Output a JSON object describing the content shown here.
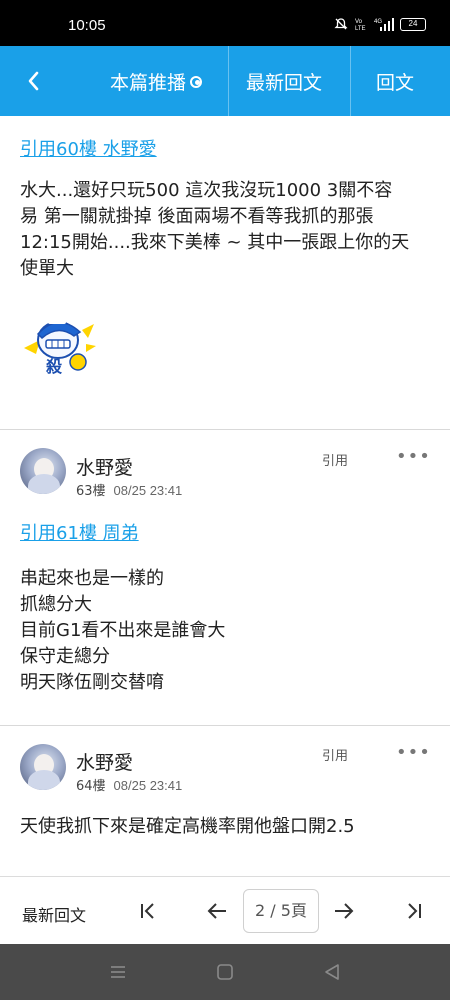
{
  "status_bar": {
    "time": "10:05",
    "battery": "24",
    "icons": [
      "mute-icon",
      "volte-icon",
      "4g-signal-icon",
      "battery-icon"
    ]
  },
  "navbar": {
    "back_icon": "chevron-left-icon",
    "tabs": [
      {
        "label": "本篇推播"
      },
      {
        "label": "最新回文"
      },
      {
        "label": "回文"
      }
    ],
    "color": "#1aa0e8"
  },
  "posts": [
    {
      "quote_link": "引用60樓 水野愛",
      "lines": [
        "水大...還好只玩500 這次我沒玩1000 3關不容",
        "易 第一關就掛掉 後面兩場不看等我抓的那張",
        "12:15開始....我來下美棒 ~ 其中一張跟上你的天",
        "使單大"
      ],
      "sticker": {
        "text": "殺",
        "icon": "baseball-cap-sticker"
      }
    },
    {
      "username": "水野愛",
      "floor": "63樓",
      "time": "08/25 23:41",
      "quote_label": "引用",
      "more_label": "•••",
      "quote_link": "引用61樓 周弟",
      "lines": [
        "串起來也是一樣的",
        "抓總分大",
        "目前G1看不出來是誰會大",
        "保守走總分",
        "明天隊伍剛交替唷"
      ]
    },
    {
      "username": "水野愛",
      "floor": "64樓",
      "time": "08/25 23:41",
      "quote_label": "引用",
      "more_label": "•••",
      "lines": [
        "天使我抓下來是確定高機率開他盤口開2.5"
      ]
    }
  ],
  "bottom_bar": {
    "latest_label": "最新回文",
    "page_indicator": "2 / 5頁",
    "icons": [
      "first-page-icon",
      "prev-page-icon",
      "next-page-icon",
      "last-page-icon"
    ]
  },
  "system_nav": {
    "icons": [
      "menu-icon",
      "home-icon",
      "back-triangle-icon"
    ]
  },
  "colors": {
    "accent": "#1aa0e8",
    "text": "#222222",
    "divider": "#d9d9d9"
  }
}
